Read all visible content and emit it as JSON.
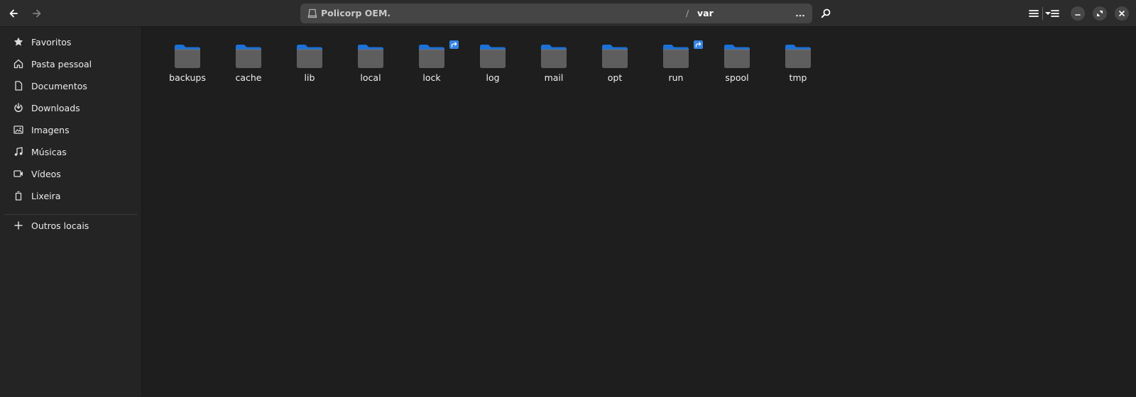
{
  "window": {
    "location_drive": "Policorp OEM.",
    "path_separator": "/",
    "current_folder": "var"
  },
  "icons": {
    "back": "go-previous-icon",
    "forward": "go-next-icon",
    "drive": "drive-harddisk-icon",
    "path_menu": "view-more-horizontal-icon",
    "search": "search-icon",
    "view_list": "view-list-icon",
    "view_options": "pan-down-icon",
    "main_menu": "open-menu-icon",
    "minimize": "window-minimize-icon",
    "restore": "window-restore-icon",
    "close": "window-close-icon"
  },
  "sidebar": {
    "items": [
      {
        "label": "Favoritos",
        "icon": "starred-icon"
      },
      {
        "label": "Pasta pessoal",
        "icon": "home-icon"
      },
      {
        "label": "Documentos",
        "icon": "document-icon"
      },
      {
        "label": "Downloads",
        "icon": "download-icon"
      },
      {
        "label": "Imagens",
        "icon": "image-icon"
      },
      {
        "label": "Músicas",
        "icon": "music-icon"
      },
      {
        "label": "Vídeos",
        "icon": "video-icon"
      },
      {
        "label": "Lixeira",
        "icon": "trash-icon"
      }
    ],
    "other_locations": {
      "label": "Outros locais",
      "icon": "plus-icon"
    }
  },
  "folders": [
    {
      "name": "backups",
      "symlink": false
    },
    {
      "name": "cache",
      "symlink": false
    },
    {
      "name": "lib",
      "symlink": false
    },
    {
      "name": "local",
      "symlink": false
    },
    {
      "name": "lock",
      "symlink": true
    },
    {
      "name": "log",
      "symlink": false
    },
    {
      "name": "mail",
      "symlink": false
    },
    {
      "name": "opt",
      "symlink": false
    },
    {
      "name": "run",
      "symlink": true
    },
    {
      "name": "spool",
      "symlink": false
    },
    {
      "name": "tmp",
      "symlink": false
    }
  ],
  "colors": {
    "folder_tab": "#1c71d8",
    "folder_body": "#5e5e5e",
    "accent": "#3584e4"
  }
}
